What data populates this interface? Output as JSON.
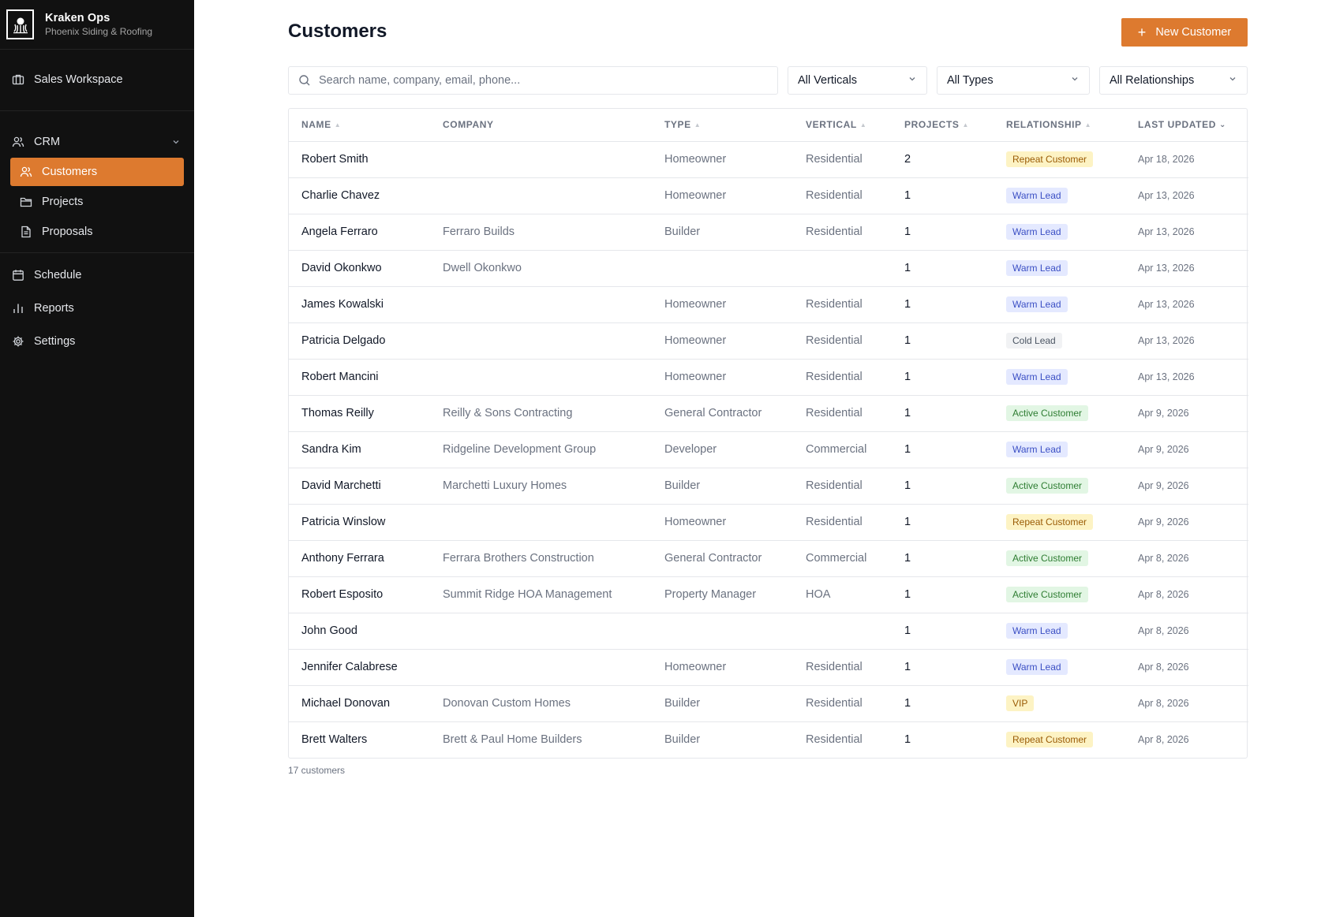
{
  "brand": {
    "title": "Kraken Ops",
    "subtitle": "Phoenix Siding & Roofing"
  },
  "sidebar": {
    "workspace": "Sales Workspace",
    "crm": "CRM",
    "crm_items": [
      "Customers",
      "Projects",
      "Proposals"
    ],
    "schedule": "Schedule",
    "reports": "Reports",
    "settings": "Settings",
    "active_item": "Customers"
  },
  "page": {
    "title": "Customers",
    "new_button": "New Customer",
    "search_placeholder": "Search name, company, email, phone...",
    "filters": {
      "vertical": "All Verticals",
      "type": "All Types",
      "relationship": "All Relationships"
    },
    "count_text": "17 customers"
  },
  "colors": {
    "accent": "#dd7a2f",
    "sidebar_bg": "#111111"
  },
  "table": {
    "headers": [
      "NAME",
      "COMPANY",
      "TYPE",
      "VERTICAL",
      "PROJECTS",
      "RELATIONSHIP",
      "LAST UPDATED"
    ],
    "rows": [
      {
        "name": "Robert Smith",
        "company": "",
        "type": "Homeowner",
        "vertical": "Residential",
        "projects": "2",
        "relationship": "Repeat Customer",
        "updated": "Apr 18, 2026"
      },
      {
        "name": "Charlie Chavez",
        "company": "",
        "type": "Homeowner",
        "vertical": "Residential",
        "projects": "1",
        "relationship": "Warm Lead",
        "updated": "Apr 13, 2026"
      },
      {
        "name": "Angela Ferraro",
        "company": "Ferraro Builds",
        "type": "Builder",
        "vertical": "Residential",
        "projects": "1",
        "relationship": "Warm Lead",
        "updated": "Apr 13, 2026"
      },
      {
        "name": "David Okonkwo",
        "company": "Dwell Okonkwo",
        "type": "",
        "vertical": "",
        "projects": "1",
        "relationship": "Warm Lead",
        "updated": "Apr 13, 2026"
      },
      {
        "name": "James Kowalski",
        "company": "",
        "type": "Homeowner",
        "vertical": "Residential",
        "projects": "1",
        "relationship": "Warm Lead",
        "updated": "Apr 13, 2026"
      },
      {
        "name": "Patricia Delgado",
        "company": "",
        "type": "Homeowner",
        "vertical": "Residential",
        "projects": "1",
        "relationship": "Cold Lead",
        "updated": "Apr 13, 2026"
      },
      {
        "name": "Robert Mancini",
        "company": "",
        "type": "Homeowner",
        "vertical": "Residential",
        "projects": "1",
        "relationship": "Warm Lead",
        "updated": "Apr 13, 2026"
      },
      {
        "name": "Thomas Reilly",
        "company": "Reilly & Sons Contracting",
        "type": "General Contractor",
        "vertical": "Residential",
        "projects": "1",
        "relationship": "Active Customer",
        "updated": "Apr 9, 2026"
      },
      {
        "name": "Sandra Kim",
        "company": "Ridgeline Development Group",
        "type": "Developer",
        "vertical": "Commercial",
        "projects": "1",
        "relationship": "Warm Lead",
        "updated": "Apr 9, 2026"
      },
      {
        "name": "David Marchetti",
        "company": "Marchetti Luxury Homes",
        "type": "Builder",
        "vertical": "Residential",
        "projects": "1",
        "relationship": "Active Customer",
        "updated": "Apr 9, 2026"
      },
      {
        "name": "Patricia Winslow",
        "company": "",
        "type": "Homeowner",
        "vertical": "Residential",
        "projects": "1",
        "relationship": "Repeat Customer",
        "updated": "Apr 9, 2026"
      },
      {
        "name": "Anthony Ferrara",
        "company": "Ferrara Brothers Construction",
        "type": "General Contractor",
        "vertical": "Commercial",
        "projects": "1",
        "relationship": "Active Customer",
        "updated": "Apr 8, 2026"
      },
      {
        "name": "Robert Esposito",
        "company": "Summit Ridge HOA Management",
        "type": "Property Manager",
        "vertical": "HOA",
        "projects": "1",
        "relationship": "Active Customer",
        "updated": "Apr 8, 2026"
      },
      {
        "name": "John Good",
        "company": "",
        "type": "",
        "vertical": "",
        "projects": "1",
        "relationship": "Warm Lead",
        "updated": "Apr 8, 2026"
      },
      {
        "name": "Jennifer Calabrese",
        "company": "",
        "type": "Homeowner",
        "vertical": "Residential",
        "projects": "1",
        "relationship": "Warm Lead",
        "updated": "Apr 8, 2026"
      },
      {
        "name": "Michael Donovan",
        "company": "Donovan Custom Homes",
        "type": "Builder",
        "vertical": "Residential",
        "projects": "1",
        "relationship": "VIP",
        "updated": "Apr 8, 2026"
      },
      {
        "name": "Brett Walters",
        "company": "Brett & Paul Home Builders",
        "type": "Builder",
        "vertical": "Residential",
        "projects": "1",
        "relationship": "Repeat Customer",
        "updated": "Apr 8, 2026"
      }
    ]
  }
}
